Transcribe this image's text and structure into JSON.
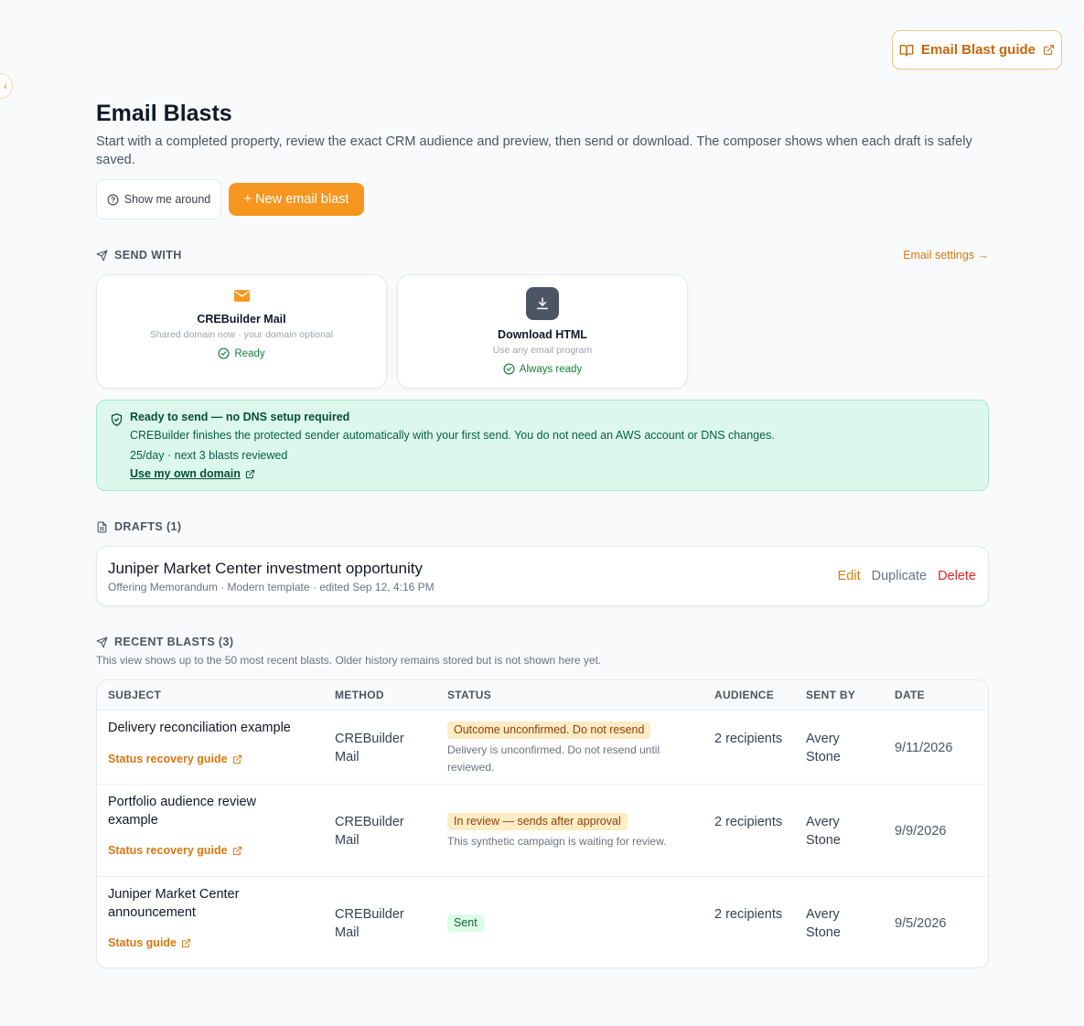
{
  "guide_button": {
    "label": "Email Blast guide"
  },
  "header": {
    "title": "Email Blasts",
    "subtitle": "Start with a completed property, review the exact CRM audience and preview, then send or download. The composer shows when each draft is safely saved."
  },
  "actions": {
    "tour_label": "Show me around",
    "new_label": "+ New email blast"
  },
  "send_with": {
    "label": "SEND WITH",
    "settings_link": "Email settings →",
    "methods": [
      {
        "icon": "envelope-icon",
        "title": "CREBuilder Mail",
        "subtitle": "Shared domain now · your domain optional",
        "status": "Ready"
      },
      {
        "icon": "download-icon",
        "title": "Download HTML",
        "subtitle": "Use any email program",
        "status": "Always ready"
      }
    ]
  },
  "ready_box": {
    "title": "Ready to send — no DNS setup required",
    "text": "CREBuilder finishes the protected sender automatically with your first send. You do not need an AWS account or DNS changes.",
    "limit": "25/day · next 3 blasts reviewed",
    "link": "Use my own domain"
  },
  "drafts": {
    "label": "DRAFTS (1)",
    "items": [
      {
        "title": "Juniper Market Center investment opportunity",
        "meta": "Offering Memorandum · Modern template · edited Sep 12, 4:16 PM",
        "edit": "Edit",
        "duplicate": "Duplicate",
        "delete": "Delete"
      }
    ]
  },
  "recent": {
    "label": "RECENT BLASTS (3)",
    "note": "This view shows up to the 50 most recent blasts. Older history remains stored but is not shown here yet.",
    "columns": [
      "SUBJECT",
      "METHOD",
      "STATUS",
      "AUDIENCE",
      "SENT BY",
      "DATE"
    ],
    "rows": [
      {
        "subject": "Delivery reconciliation example",
        "guide": "Status recovery guide",
        "method": "CREBuilder Mail",
        "status": "Outcome unconfirmed. Do not resend",
        "status_note": "Delivery is unconfirmed. Do not resend until reviewed.",
        "audience": "2 recipients",
        "sent_by": "Avery Stone",
        "date": "9/11/2026"
      },
      {
        "subject": "Portfolio audience review example",
        "guide": "Status recovery guide",
        "method": "CREBuilder Mail",
        "status": "In review — sends after approval",
        "status_note": "This synthetic campaign is waiting for review.",
        "audience": "2 recipients",
        "sent_by": "Avery Stone",
        "date": "9/9/2026"
      },
      {
        "subject": "Juniper Market Center announcement",
        "guide": "Status guide",
        "method": "CREBuilder Mail",
        "status": "Sent",
        "status_note": "",
        "audience": "2 recipients",
        "sent_by": "Avery Stone",
        "date": "9/5/2026"
      }
    ]
  },
  "colors": {
    "accent": "#f5961f",
    "success": "#15803d",
    "danger": "#dc2626"
  }
}
